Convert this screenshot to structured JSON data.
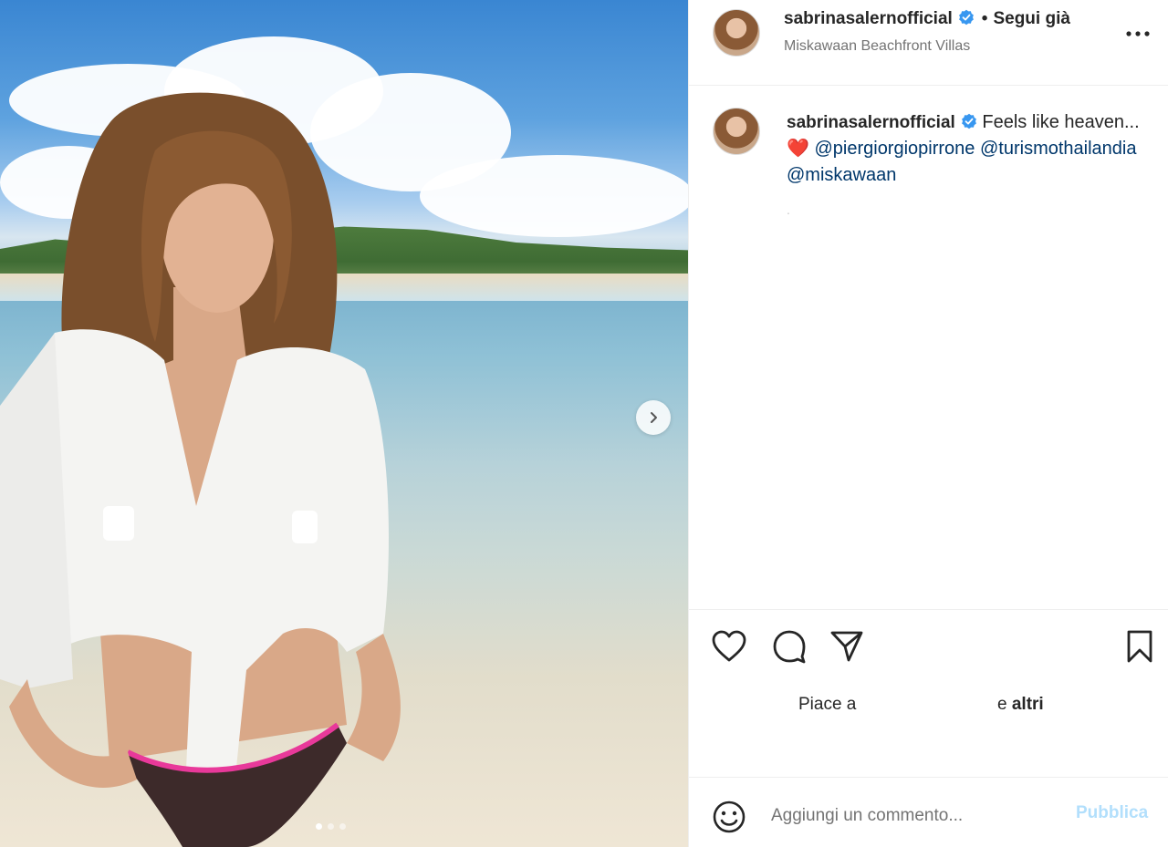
{
  "post": {
    "username": "sabrinasalernofficial",
    "follow_status": "Segui già",
    "separator": "•",
    "location": "Miskawaan Beachfront Villas"
  },
  "caption": {
    "username": "sabrinasalernofficial",
    "text": "Feels like heaven...",
    "heart_emoji": "❤️",
    "mentions": [
      "@piergiorgiopirrone",
      "@turismothailandia",
      "@miskawaan"
    ]
  },
  "media": {
    "carousel_count": 3,
    "carousel_active_index": 0
  },
  "likes": {
    "prefix": "Piace a",
    "connector": "e",
    "suffix": "altri"
  },
  "comment": {
    "placeholder": "Aggiungi un commento...",
    "publish_label": "Pubblica"
  },
  "colors": {
    "verified": "#3897f0",
    "link": "#00376b",
    "publish_disabled": "#b2dffc"
  },
  "icons": [
    "verified-badge-icon",
    "more-options-icon",
    "chevron-right-icon",
    "heart-icon",
    "comment-icon",
    "share-icon",
    "bookmark-icon",
    "emoji-icon"
  ]
}
